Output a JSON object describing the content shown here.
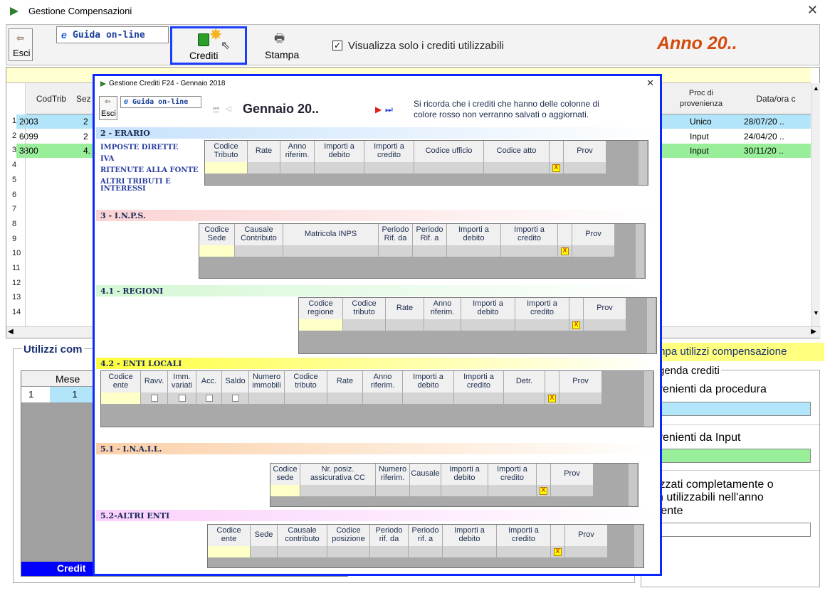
{
  "window": {
    "title": "Gestione Compensazioni"
  },
  "toolbar": {
    "exit": "Esci",
    "guide": "Guida on-line",
    "credits": "Crediti",
    "print": "Stampa",
    "filter_label": "Visualizza solo i crediti utilizzabili",
    "filter_checked": true,
    "year": "Anno 20.."
  },
  "grid": {
    "headers": [
      "CodTrib",
      "Sez",
      "Proc di provenienza",
      "Data/ora c"
    ],
    "row_numbers": [
      "1",
      "2",
      "3",
      "4",
      "5",
      "6",
      "7",
      "8",
      "9",
      "10",
      "11",
      "12",
      "13",
      "14"
    ],
    "rows": [
      {
        "codtrib": "2003",
        "sez": "2",
        "proc": "Unico",
        "date": "28/07/20 .."
      },
      {
        "codtrib": "6099",
        "sez": "2",
        "proc": "Input",
        "date": "24/04/20 .."
      },
      {
        "codtrib": "3800",
        "sez": "4.",
        "proc": "Input",
        "date": "30/11/20 .."
      }
    ]
  },
  "utilizzi": {
    "title": "Utilizzi com",
    "col_mese": "Mese",
    "row_num": "1",
    "row_mese": "1",
    "bottom": "Credit"
  },
  "right_panel": {
    "print_btn": "mpa utilizzi compensazione",
    "legend_title": "genda crediti",
    "from_proc": "venienti da procedura",
    "from_input": "venienti da Input",
    "used": "izzati completamente o\nn utilizzabili nell'anno\nrente"
  },
  "colors": {
    "proc_row": "#b2e4fa",
    "input_row": "#99ee99",
    "dialog_border": "#0a28ff",
    "erario": "#c6e1fb",
    "inps": "#fbd3d3",
    "regioni": "#d4f7d4",
    "enti": "#ffff3c",
    "inail": "#fbd0a8",
    "altri": "#fbd0fb"
  },
  "dialog": {
    "title": "Gestione Crediti F24 - Gennaio 2018",
    "exit": "Esci",
    "guide": "Guida on-line",
    "month": "Gennaio 20..",
    "note": "Si ricorda che i crediti che hanno delle colonne di\ncolore rosso non verranno salvati o aggiornati.",
    "erario": {
      "title": "2 - ERARIO",
      "labels": [
        "IMPOSTE DIRETTE",
        "IVA",
        "RITENUTE ALLA FONTE",
        "ALTRI TRIBUTI E\nINTERESSI"
      ],
      "cols": [
        "Codice\nTributo",
        "Rate",
        "Anno\nriferim.",
        "Importi a\ndebito",
        "Importi a\ncredito",
        "Codice ufficio",
        "Codice atto",
        "",
        "Prov"
      ]
    },
    "inps": {
      "title": "3 - I.N.P.S.",
      "cols": [
        "Codice\nSede",
        "Causale\nContributo",
        "Matricola INPS",
        "Periodo\nRif. da",
        "Periodo\nRif. a",
        "Importi a\ndebito",
        "Importi a\ncredito",
        "",
        "Prov"
      ]
    },
    "regioni": {
      "title": "4.1 - REGIONI",
      "cols": [
        "Codice\nregione",
        "Codice\ntributo",
        "Rate",
        "Anno\nriferim.",
        "Importi a\ndebito",
        "Importi a\ncredito",
        "",
        "Prov"
      ]
    },
    "enti": {
      "title": "4.2 - ENTI LOCALI",
      "cols": [
        "Codice\nente",
        "Ravv.",
        "Imm.\nvariati",
        "Acc.",
        "Saldo",
        "Numero\nimmobili",
        "Codice\ntributo",
        "Rate",
        "Anno\nriferim.",
        "Importi a\ndebito",
        "Importi a\ncredito",
        "Detr.",
        "",
        "Prov"
      ]
    },
    "inail": {
      "title": "5.1 - I.N.A.I.L.",
      "cols": [
        "Codice\nsede",
        "Nr. posiz.\nassicurativa CC",
        "Numero\nriferim.",
        "Causale",
        "Importi a\ndebito",
        "Importi a\ncredito",
        "",
        "Prov"
      ]
    },
    "altri": {
      "title": "5.2-ALTRI ENTI",
      "cols": [
        "Codice\nente",
        "Sede",
        "Causale\ncontributo",
        "Codice\nposizione",
        "Periodo\nrif. da",
        "Periodo\nrif. a",
        "Importi a\ndebito",
        "Importi a\ncredito",
        "",
        "Prov"
      ]
    },
    "x_mark": "X"
  }
}
